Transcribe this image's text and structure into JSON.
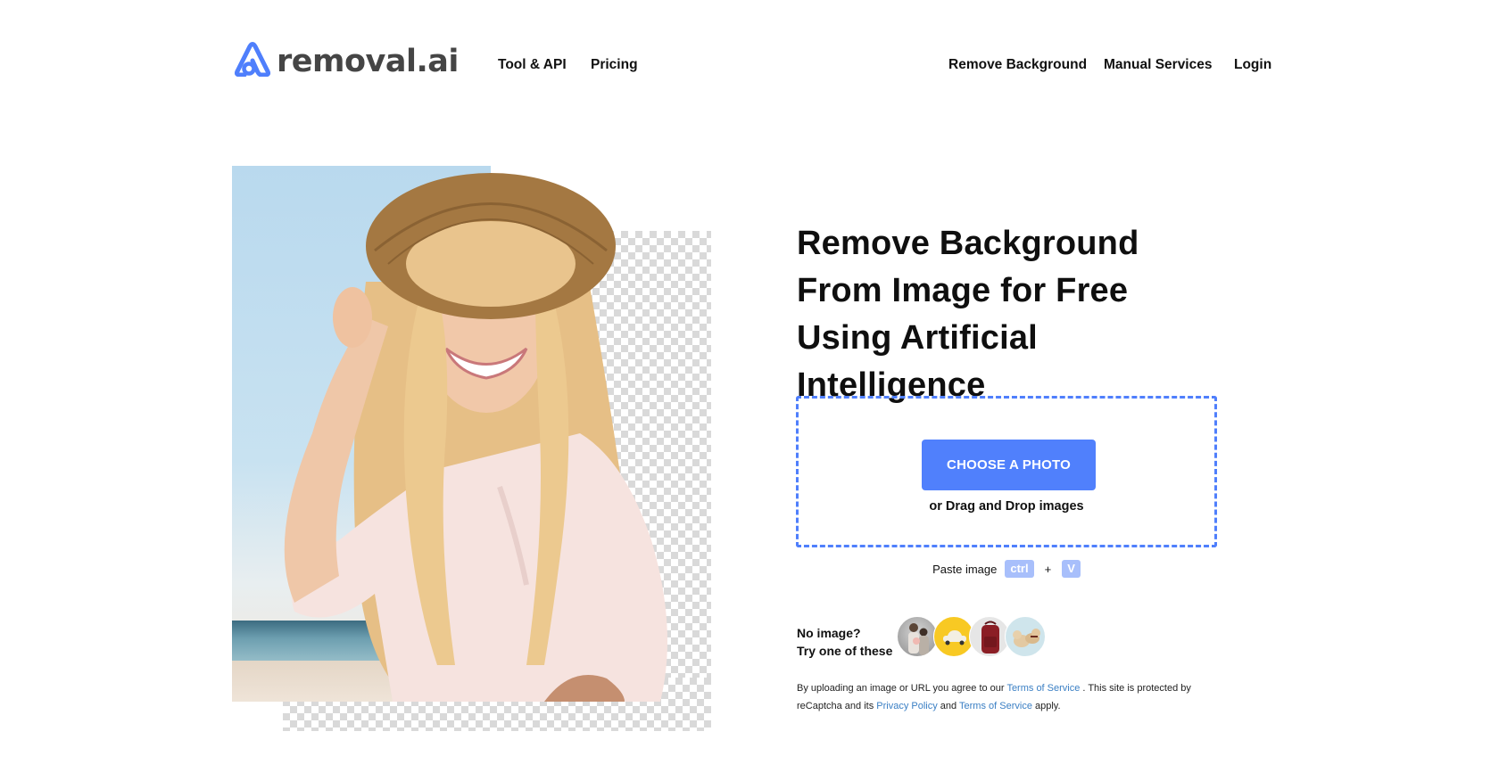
{
  "brand": {
    "name": "removal.ai",
    "accent_color": "#4f7ffc",
    "button_color": "#5080fc",
    "logo_icon": "removal-ai-arch-icon"
  },
  "nav": {
    "left": [
      {
        "label": "Tool & API"
      },
      {
        "label": "Pricing"
      }
    ],
    "right": [
      {
        "label": "Remove Background"
      },
      {
        "label": "Manual Services"
      },
      {
        "label": "Login"
      }
    ]
  },
  "hero": {
    "image_description": "Smiling woman in straw hat on beach, background partially removed (transparent checkerboard)",
    "headline": "Remove Background From Image for Free Using Artificial Intelligence"
  },
  "upload": {
    "button_label": "CHOOSE A PHOTO",
    "drag_text": "or Drag and Drop images",
    "paste_label": "Paste image",
    "key_ctrl": "ctrl",
    "plus": "+",
    "key_v": "V"
  },
  "samples": {
    "label_line1": "No image?",
    "label_line2": "Try one of these",
    "items": [
      {
        "name": "family-photo"
      },
      {
        "name": "car-photo"
      },
      {
        "name": "backpack-photo"
      },
      {
        "name": "dogs-photo"
      }
    ]
  },
  "legal": {
    "text1": "By uploading an image or URL you agree to our ",
    "link1": "Terms of Service",
    "text2": " . This site is protected by reCaptcha and its ",
    "link2": "Privacy Policy",
    "text3": " and ",
    "link3": "Terms of Service",
    "text4": " apply."
  }
}
